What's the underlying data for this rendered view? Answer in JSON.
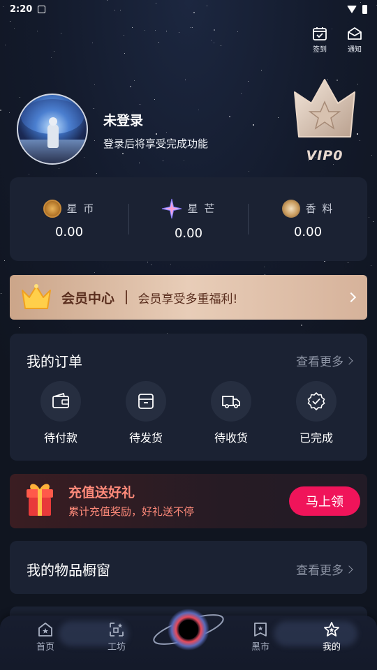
{
  "status_bar": {
    "time": "2:20"
  },
  "top_actions": [
    {
      "label": "签到",
      "icon": "calendar-check-icon"
    },
    {
      "label": "通知",
      "icon": "envelope-icon"
    }
  ],
  "profile": {
    "name": "未登录",
    "hint": "登录后将享受完成功能",
    "vip_label": "VIP0"
  },
  "wallet": [
    {
      "label": "星 币",
      "value": "0.00",
      "icon": "star-coin-icon"
    },
    {
      "label": "星 芒",
      "value": "0.00",
      "icon": "star-burst-icon"
    },
    {
      "label": "香 料",
      "value": "0.00",
      "icon": "spice-icon"
    }
  ],
  "member_center": {
    "title": "会员中心",
    "subtitle": "会员享受多重福利!"
  },
  "orders": {
    "title": "我的订单",
    "more": "查看更多",
    "items": [
      {
        "label": "待付款",
        "icon": "wallet-icon"
      },
      {
        "label": "待发货",
        "icon": "box-icon"
      },
      {
        "label": "待收货",
        "icon": "truck-icon"
      },
      {
        "label": "已完成",
        "icon": "check-badge-icon"
      }
    ]
  },
  "recharge": {
    "title": "充值送好礼",
    "subtitle": "累计充值奖励，好礼送不停",
    "button": "马上领"
  },
  "showcase": {
    "title": "我的物品橱窗",
    "more": "查看更多"
  },
  "tabs": [
    {
      "label": "首页",
      "icon": "home-icon",
      "active": false
    },
    {
      "label": "工坊",
      "icon": "workshop-icon",
      "active": false
    },
    {
      "label": "黑市",
      "icon": "market-icon",
      "active": false
    },
    {
      "label": "我的",
      "icon": "star-icon",
      "active": true
    }
  ],
  "colors": {
    "background": "#101520",
    "card": "#1b2233",
    "accent_pink": "#f0145a",
    "recharge_text": "#ff8a7a",
    "member_text": "#5a2e1e"
  }
}
